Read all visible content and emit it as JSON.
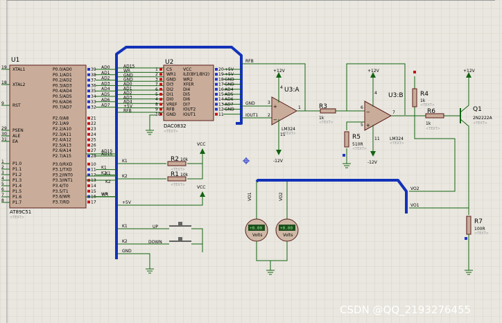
{
  "u1": {
    "ref": "U1",
    "part": "AT89C51",
    "text_tag": "<TEXT>",
    "left_pins": [
      {
        "num": "19",
        "name": "XTAL1"
      },
      {
        "num": "18",
        "name": "XTAL2"
      },
      {
        "num": "9",
        "name": "RST"
      },
      {
        "num": "29",
        "name": "PSEN"
      },
      {
        "num": "30",
        "name": "ALE"
      },
      {
        "num": "31",
        "name": "EA"
      },
      {
        "num": "1",
        "name": "P1.0"
      },
      {
        "num": "2",
        "name": "P1.1"
      },
      {
        "num": "3",
        "name": "P1.2"
      },
      {
        "num": "4",
        "name": "P1.3"
      },
      {
        "num": "5",
        "name": "P1.4"
      },
      {
        "num": "6",
        "name": "P1.5"
      },
      {
        "num": "7",
        "name": "P1.6"
      },
      {
        "num": "8",
        "name": "P1.7"
      }
    ],
    "right_pins": [
      {
        "name": "P0.0/AD0",
        "num": "39",
        "net": "AD0"
      },
      {
        "name": "P0.1/AD1",
        "num": "38",
        "net": "AD1"
      },
      {
        "name": "P0.2/AD2",
        "num": "37",
        "net": "AD2"
      },
      {
        "name": "P0.3/AD3",
        "num": "36",
        "net": "AD3"
      },
      {
        "name": "P0.4/AD4",
        "num": "35",
        "net": "AD4"
      },
      {
        "name": "P0.5/AD5",
        "num": "34",
        "net": "AD5"
      },
      {
        "name": "P0.6/AD6",
        "num": "33",
        "net": "AD6"
      },
      {
        "name": "P0.7/AD7",
        "num": "32",
        "net": "AD7"
      },
      {
        "name": "P2.0/A8",
        "num": "21",
        "net": ""
      },
      {
        "name": "P2.1/A9",
        "num": "22",
        "net": ""
      },
      {
        "name": "P2.2/A10",
        "num": "23",
        "net": ""
      },
      {
        "name": "P2.3/A11",
        "num": "24",
        "net": ""
      },
      {
        "name": "P2.4/A12",
        "num": "25",
        "net": ""
      },
      {
        "name": "P2.5/A13",
        "num": "26",
        "net": ""
      },
      {
        "name": "P2.6/A14",
        "num": "27",
        "net": ""
      },
      {
        "name": "P2.7/A15",
        "num": "28",
        "net": "AD15"
      },
      {
        "name": "P3.0/RXD",
        "num": "10",
        "net": ""
      },
      {
        "name": "P3.1/TXD",
        "num": "11",
        "net": "K1"
      },
      {
        "name": "P3.2/INT0",
        "num": "12",
        "net": "K2"
      },
      {
        "name": "P3.3/INT1",
        "num": "13",
        "net": ""
      },
      {
        "name": "P3.4/T0",
        "num": "14",
        "net": ""
      },
      {
        "name": "P3.5/T1",
        "num": "15",
        "net": ""
      },
      {
        "name": "P3.6/WR",
        "num": "16",
        "net": "WR"
      },
      {
        "name": "P3.7/RD",
        "num": "17",
        "net": ""
      }
    ]
  },
  "u2": {
    "ref": "U2",
    "part": "DAC0832",
    "text_tag": "<TEXT>",
    "left_nets": [
      "AD15",
      "WR",
      "GND",
      "GND",
      "AD0",
      "AD1",
      "AD2",
      "AD3",
      "AD4",
      "+5V",
      "RFB"
    ],
    "left_pins": [
      {
        "num": "1",
        "name": "CS"
      },
      {
        "num": "2",
        "name": "WR1"
      },
      {
        "num": "3",
        "name": "GND"
      },
      {
        "num": "7",
        "name": "DI3"
      },
      {
        "num": "6",
        "name": "DI2"
      },
      {
        "num": "5",
        "name": "DI1"
      },
      {
        "num": "4",
        "name": "DI0"
      },
      {
        "num": "8",
        "name": "VREF"
      },
      {
        "num": "9",
        "name": "RFB"
      },
      {
        "num": "10",
        "name": "GND"
      }
    ],
    "right_pins": [
      {
        "num": "20",
        "name": "VCC",
        "net": "+5V"
      },
      {
        "num": "19",
        "name": "ILE(BY1/BY2)",
        "net": "+5V"
      },
      {
        "num": "18",
        "name": "WR2",
        "net": "GND"
      },
      {
        "num": "17",
        "name": "XFER",
        "net": "GND"
      },
      {
        "num": "16",
        "name": "DI4",
        "net": "AD4"
      },
      {
        "num": "15",
        "name": "DI5",
        "net": "AD5"
      },
      {
        "num": "14",
        "name": "DI6",
        "net": "AD6"
      },
      {
        "num": "13",
        "name": "DI7",
        "net": "AD7"
      },
      {
        "num": "12",
        "name": "IOUT2",
        "net": "GND"
      },
      {
        "num": "11",
        "name": "IOUT1",
        "net": ""
      }
    ]
  },
  "u3a": {
    "ref": "U3:A",
    "part": "LM324",
    "text_tag": "<TEXT>",
    "vpos": "+12V",
    "vneg": "-12V",
    "pin_plus": "3",
    "pin_minus": "2",
    "pin_out": "1",
    "pin_v": "4",
    "pin_g": "11"
  },
  "u3b": {
    "ref": "U3:B",
    "part": "LM324",
    "text_tag": "<TEXT>",
    "vpos": "+12V",
    "vneg": "-12V",
    "pin_plus": "5",
    "pin_minus": "6",
    "pin_out": "7",
    "pin_v": "4",
    "pin_g": "11"
  },
  "resistors": {
    "r1": {
      "ref": "R1",
      "value": "10k",
      "text_tag": "<TEXT>"
    },
    "r2": {
      "ref": "R2",
      "value": "10k",
      "text_tag": "<TEXT>"
    },
    "r3": {
      "ref": "R3",
      "value": "1k",
      "text_tag": "<TEXT>"
    },
    "r4": {
      "ref": "R4",
      "value": "1k",
      "text_tag": "<TEXT>"
    },
    "r5": {
      "ref": "R5",
      "value": "510R",
      "text_tag": "<TEXT>"
    },
    "r6": {
      "ref": "R6",
      "value": "1k",
      "text_tag": "<TEXT>"
    },
    "r7": {
      "ref": "R7",
      "value": "100R",
      "text_tag": "<TEXT>"
    }
  },
  "q1": {
    "ref": "Q1",
    "part": "2N2222A",
    "text_tag": "<TEXT>",
    "supply": "+12V"
  },
  "nets": {
    "rfb": "RFB",
    "gnd": "GND",
    "iout1": "IOUT1",
    "vcc": "VCC",
    "plus5v": "+5V",
    "k1": "K1",
    "k2": "K2",
    "wr": "WR",
    "ad15": "AD15",
    "vo1": "VO1",
    "vo2": "VO2"
  },
  "buttons": {
    "up": "UP",
    "down": "DOWN"
  },
  "meters": [
    {
      "net": "VO1",
      "reading": "+0.00",
      "unit": "Volts"
    },
    {
      "net": "VO2",
      "reading": "+0.00",
      "unit": "Volts"
    }
  ],
  "watermark": "CSDN @QQ_2193276455",
  "colors": {
    "background": "#e9e7df",
    "wire": "#126312",
    "bus": "#1232b8",
    "chip": "#c9ad9a",
    "pin_high": "#c81414",
    "pin_low": "#2433c8"
  }
}
